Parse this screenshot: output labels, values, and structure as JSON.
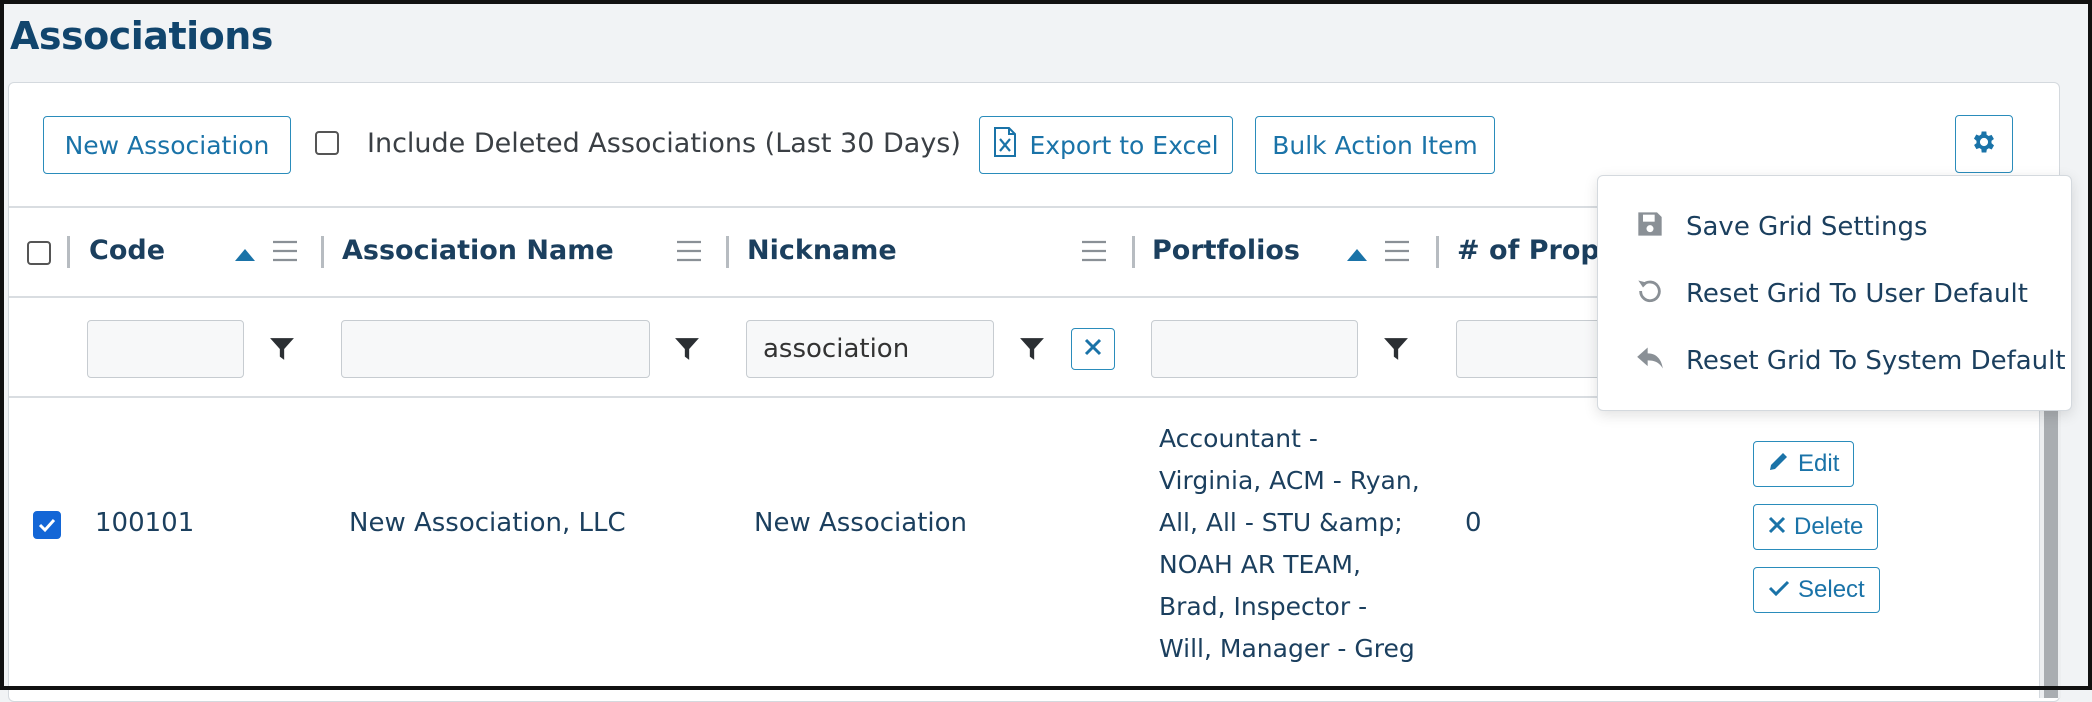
{
  "page": {
    "title": "Associations"
  },
  "toolbar": {
    "new_association": "New Association",
    "include_deleted_label": "Include Deleted Associations (Last 30 Days)",
    "export_excel": "Export to Excel",
    "bulk_action": "Bulk Action Item"
  },
  "columns": {
    "code": "Code",
    "association_name": "Association Name",
    "nickname": "Nickname",
    "portfolios": "Portfolios",
    "num_properties": "# of Prope"
  },
  "filters": {
    "nickname_value": "association"
  },
  "row": {
    "code": "100101",
    "association_name": "New Association, LLC",
    "nickname": "New Association",
    "portfolios_lines": [
      "Accountant -",
      "Virginia, ACM - Ryan,",
      "All, All - STU &amp;",
      "NOAH AR TEAM,",
      "Brad, Inspector -",
      "Will, Manager - Greg"
    ],
    "num_properties": "0",
    "edit": "Edit",
    "delete": "Delete",
    "select": "Select"
  },
  "settings_menu": {
    "save": "Save Grid Settings",
    "reset_user": "Reset Grid To User Default",
    "reset_system": "Reset Grid To System Default"
  },
  "colors": {
    "accent": "#1a73a8",
    "title": "#11456d",
    "checkbox_checked": "#1366d6"
  }
}
